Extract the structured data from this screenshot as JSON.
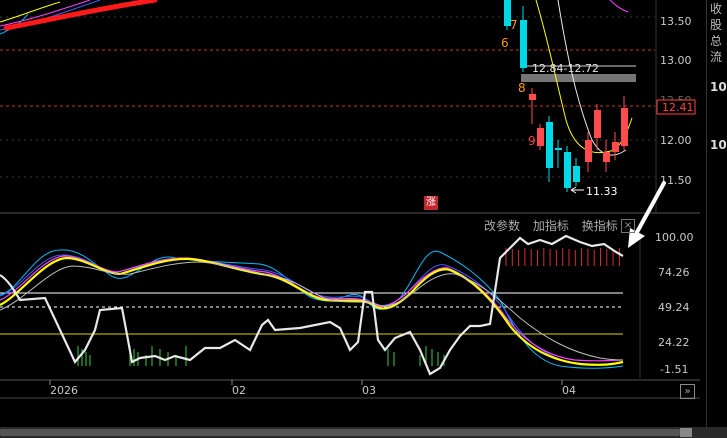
{
  "price_axis": {
    "ticks": [
      "13.50",
      "13.00",
      "12.50",
      "12.00",
      "11.50"
    ],
    "current_price": "12.41",
    "current_price_color": "#ff4040"
  },
  "price_chart": {
    "range_label": "12.84-12.72",
    "low_label": "11.33",
    "signal_numbers": [
      "7",
      "6",
      "8",
      "9"
    ],
    "up_color": "#ff4b4b",
    "down_color": "#00d8e8"
  },
  "badge": {
    "label": "涨"
  },
  "indicator_toolbar": {
    "change_params": "改参数",
    "add_indicator": "加指标",
    "switch_indicator": "换指标",
    "close_symbol": "×"
  },
  "indicator_axis": {
    "ticks": [
      "100.00",
      "74.26",
      "49.24",
      "24.22",
      "-1.51"
    ]
  },
  "time_axis": {
    "labels": [
      "2026",
      "02",
      "03",
      "04"
    ]
  },
  "scroll_button": {
    "label": "»"
  },
  "right_panel": {
    "lines": [
      "收",
      "股",
      "总",
      "流",
      "10",
      "10"
    ]
  },
  "colors": {
    "background": "#000000",
    "grid_dashed": "#c0392b",
    "reference_white": "#ffffff",
    "reference_yellow": "#e0d000",
    "line_white": "#e8e8e8",
    "line_yellow": "#ffff00",
    "line_magenta": "#ff40ff",
    "line_blue": "#4060ff",
    "line_cyan": "#00bfff",
    "line_gray": "#bdbdbd",
    "arrow": "#ffffff",
    "red_trend": "#ff1a1a"
  }
}
